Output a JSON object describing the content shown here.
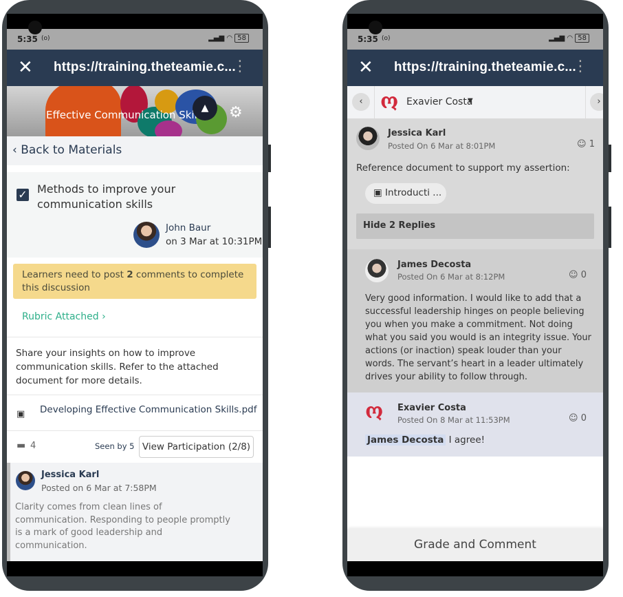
{
  "status": {
    "time": "5:35",
    "extra": "(o)",
    "battery": "58"
  },
  "browser": {
    "url": "https://training.theteamie.c..."
  },
  "left": {
    "banner_title": "Effective Communication Skills",
    "back": "Back to Materials",
    "discussion_title": "Methods to improve your communication skills",
    "author": "John Baur",
    "author_date": "on 3 Mar at 10:31PM",
    "notice_pre": "Learners need to post ",
    "notice_count": "2",
    "notice_post": " comments to complete this discussion",
    "rubric": "Rubric Attached",
    "description": "Share your insights on how to improve communication skills. Refer to the attached document for more details.",
    "attachment": "Developing Effective Communication Skills.pdf",
    "comment_count": "4",
    "seen_by": "Seen by 5",
    "view_participation": "View Participation (2/8)",
    "post": {
      "name": "Jessica Karl",
      "date": "Posted on 6 Mar at 7:58PM",
      "text": "Clarity comes from clean lines of communication. Responding to people promptly is a mark of good leadership and communication."
    }
  },
  "right": {
    "selected_user": "Exavier Costa",
    "post": {
      "name": "Jessica Karl",
      "date": "Posted On 6 Mar at 8:01PM",
      "reactions": "1",
      "text": "Reference document to support my assertion:",
      "attachment": "Introducti ..."
    },
    "hide_replies": "Hide 2 Replies",
    "reply1": {
      "name": "James Decosta",
      "date": "Posted On 6 Mar at 8:12PM",
      "reactions": "0",
      "text": "Very good information. I would like to add that a successful leadership hinges on people believing you when you make a commitment. Not doing what you said you would is an integrity issue. Your actions (or inaction) speak louder than your words. The servant’s heart in a leader ultimately drives your ability to follow through."
    },
    "reply2": {
      "name": "Exavier Costa",
      "date": "Posted On 8 Mar at 11:53PM",
      "reactions": "0",
      "mention": "James Decosta",
      "text": "I agree!"
    },
    "grade_button": "Grade and Comment"
  },
  "colors": {
    "toolbar": "#2a3b52",
    "notice": "#f5d98c",
    "rubric": "#2eaf8a",
    "brand_logo": "#d22a3c"
  }
}
